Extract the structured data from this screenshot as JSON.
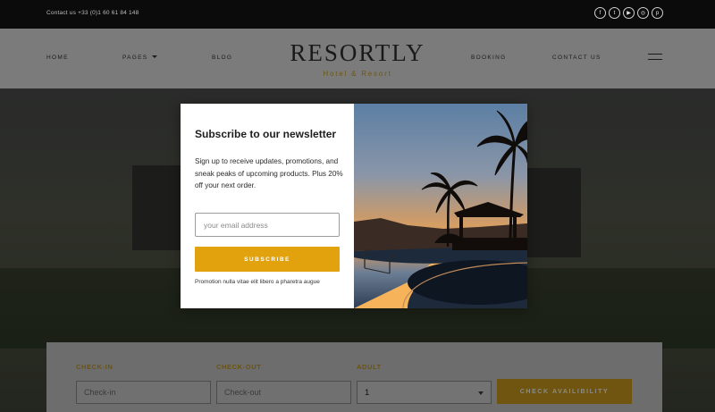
{
  "topbar": {
    "contact": "Contact us +33 (0)1 60 61 84 148",
    "socials": [
      {
        "icon": "facebook-icon",
        "glyph": "f"
      },
      {
        "icon": "twitter-icon",
        "glyph": "t"
      },
      {
        "icon": "youtube-icon",
        "glyph": "▶"
      },
      {
        "icon": "instagram-icon",
        "glyph": "◎"
      },
      {
        "icon": "pinterest-icon",
        "glyph": "p"
      }
    ]
  },
  "nav": {
    "home": "HOME",
    "pages": "PAGES",
    "blog": "BLOG",
    "booking": "BOOKING",
    "contact": "CONTACT US"
  },
  "logo": {
    "title": "RESORTLY",
    "subtitle": "Hotel & Resort"
  },
  "popup": {
    "title": "Subscribe to our newsletter",
    "description": "Sign up to receive updates, promotions, and sneak peaks of upcoming products. Plus 20% off your next order.",
    "email_placeholder": "your email address",
    "subscribe_label": "SUBSCRIBE",
    "note": "Promotion nulla vitae elit libero a pharetra augue"
  },
  "booking": {
    "checkin_label": "CHECK-IN",
    "checkin_placeholder": "Check-in",
    "checkout_label": "CHECK-OUT",
    "checkout_placeholder": "Check-out",
    "adult_label": "ADULT",
    "adult_value": "1",
    "button_label": "CHECK AVAILIBILITY"
  },
  "colors": {
    "accent": "#e2a20e",
    "topbar_bg": "#0b0b0b",
    "overlay": "#000000"
  }
}
